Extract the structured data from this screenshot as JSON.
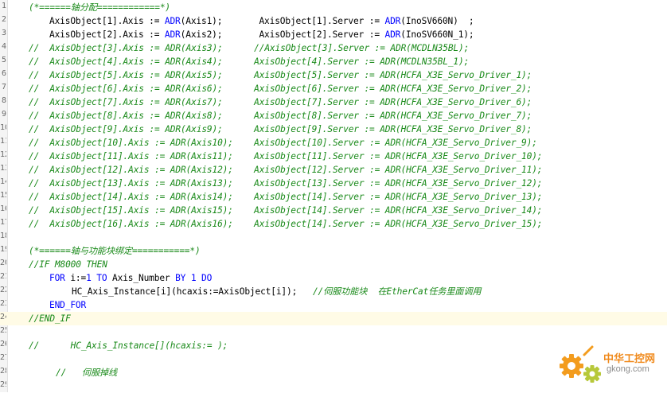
{
  "editor": {
    "lines": [
      {
        "num": "1",
        "segs": [
          {
            "t": "(*======轴分配============*)",
            "c": "cm"
          }
        ]
      },
      {
        "num": "2",
        "segs": [
          {
            "t": "AxisObject[1].Axis := ",
            "c": "txt"
          },
          {
            "t": "ADR",
            "c": "kw"
          },
          {
            "t": "(Axis1);       AxisObject[1].Server := ",
            "c": "txt"
          },
          {
            "t": "ADR",
            "c": "kw"
          },
          {
            "t": "(InoSV660N)  ;",
            "c": "txt"
          }
        ]
      },
      {
        "num": "3",
        "segs": [
          {
            "t": "AxisObject[2].Axis := ",
            "c": "txt"
          },
          {
            "t": "ADR",
            "c": "kw"
          },
          {
            "t": "(Axis2);       AxisObject[2].Server := ",
            "c": "txt"
          },
          {
            "t": "ADR",
            "c": "kw"
          },
          {
            "t": "(InoSV660N_1);",
            "c": "txt"
          }
        ]
      },
      {
        "num": "4",
        "segs": [
          {
            "t": "//  AxisObject[3].Axis := ADR(Axis3);      //AxisObject[3].Server := ADR(MCDLN35BL);",
            "c": "cm"
          }
        ]
      },
      {
        "num": "5",
        "segs": [
          {
            "t": "//  AxisObject[4].Axis := ADR(Axis4);      AxisObject[4].Server := ADR(MCDLN35BL_1);",
            "c": "cm"
          }
        ]
      },
      {
        "num": "6",
        "segs": [
          {
            "t": "//  AxisObject[5].Axis := ADR(Axis5);      AxisObject[5].Server := ADR(HCFA_X3E_Servo_Driver_1);",
            "c": "cm"
          }
        ]
      },
      {
        "num": "7",
        "segs": [
          {
            "t": "//  AxisObject[6].Axis := ADR(Axis6);      AxisObject[6].Server := ADR(HCFA_X3E_Servo_Driver_2);",
            "c": "cm"
          }
        ]
      },
      {
        "num": "8",
        "segs": [
          {
            "t": "//  AxisObject[7].Axis := ADR(Axis7);      AxisObject[7].Server := ADR(HCFA_X3E_Servo_Driver_6);",
            "c": "cm"
          }
        ]
      },
      {
        "num": "9",
        "segs": [
          {
            "t": "//  AxisObject[8].Axis := ADR(Axis8);      AxisObject[8].Server := ADR(HCFA_X3E_Servo_Driver_7);",
            "c": "cm"
          }
        ]
      },
      {
        "num": "10",
        "segs": [
          {
            "t": "//  AxisObject[9].Axis := ADR(Axis9);      AxisObject[9].Server := ADR(HCFA_X3E_Servo_Driver_8);",
            "c": "cm"
          }
        ]
      },
      {
        "num": "11",
        "segs": [
          {
            "t": "//  AxisObject[10].Axis := ADR(Axis10);    AxisObject[10].Server := ADR(HCFA_X3E_Servo_Driver_9);",
            "c": "cm"
          }
        ]
      },
      {
        "num": "12",
        "segs": [
          {
            "t": "//  AxisObject[11].Axis := ADR(Axis11);    AxisObject[11].Server := ADR(HCFA_X3E_Servo_Driver_10);",
            "c": "cm"
          }
        ]
      },
      {
        "num": "13",
        "segs": [
          {
            "t": "//  AxisObject[12].Axis := ADR(Axis12);    AxisObject[12].Server := ADR(HCFA_X3E_Servo_Driver_11);",
            "c": "cm"
          }
        ]
      },
      {
        "num": "14",
        "segs": [
          {
            "t": "//  AxisObject[13].Axis := ADR(Axis13);    AxisObject[13].Server := ADR(HCFA_X3E_Servo_Driver_12);",
            "c": "cm"
          }
        ]
      },
      {
        "num": "15",
        "segs": [
          {
            "t": "//  AxisObject[14].Axis := ADR(Axis14);    AxisObject[14].Server := ADR(HCFA_X3E_Servo_Driver_13);",
            "c": "cm"
          }
        ]
      },
      {
        "num": "16",
        "segs": [
          {
            "t": "//  AxisObject[15].Axis := ADR(Axis15);    AxisObject[14].Server := ADR(HCFA_X3E_Servo_Driver_14);",
            "c": "cm"
          }
        ]
      },
      {
        "num": "17",
        "segs": [
          {
            "t": "//  AxisObject[16].Axis := ADR(Axis16);    AxisObject[14].Server := ADR(HCFA_X3E_Servo_Driver_15);",
            "c": "cm"
          }
        ]
      },
      {
        "num": "18",
        "segs": []
      },
      {
        "num": "19",
        "segs": [
          {
            "t": "(*======轴与功能块绑定===========*)",
            "c": "cm"
          }
        ]
      },
      {
        "num": "20",
        "segs": [
          {
            "t": "//IF M8000 THEN",
            "c": "cm"
          }
        ]
      },
      {
        "num": "21",
        "segs": [
          {
            "t": "FOR",
            "c": "kw"
          },
          {
            "t": " i:=",
            "c": "txt"
          },
          {
            "t": "1",
            "c": "kw"
          },
          {
            "t": " ",
            "c": "txt"
          },
          {
            "t": "TO",
            "c": "kw"
          },
          {
            "t": " Axis_Number ",
            "c": "txt"
          },
          {
            "t": "BY",
            "c": "kw"
          },
          {
            "t": " ",
            "c": "txt"
          },
          {
            "t": "1",
            "c": "kw"
          },
          {
            "t": " ",
            "c": "txt"
          },
          {
            "t": "DO",
            "c": "kw"
          }
        ]
      },
      {
        "num": "22",
        "segs": [
          {
            "t": "HC_Axis_Instance[i](hcaxis:=AxisObject[i]);   ",
            "c": "txt"
          },
          {
            "t": "//伺服功能块  在EtherCat任务里面调用",
            "c": "cm"
          }
        ]
      },
      {
        "num": "23",
        "segs": [
          {
            "t": "END_FOR",
            "c": "kw"
          }
        ]
      },
      {
        "num": "24",
        "segs": [
          {
            "t": "//END_IF",
            "c": "cm"
          }
        ]
      },
      {
        "num": "25",
        "segs": []
      },
      {
        "num": "26",
        "segs": [
          {
            "t": "//      HC_Axis_Instance[](hcaxis:= );",
            "c": "cm"
          }
        ]
      },
      {
        "num": "27",
        "segs": []
      },
      {
        "num": "28",
        "segs": [
          {
            "t": "//   伺服掉线",
            "c": "cm"
          }
        ]
      },
      {
        "num": "29",
        "segs": []
      }
    ]
  },
  "watermark": {
    "title": "中华工控网",
    "domain": "gkong.com",
    "icon": "gear-icon",
    "gear_colors": [
      "#f39c1e",
      "#b7c83a"
    ]
  },
  "colors": {
    "keyword": "#0000ff",
    "comment": "#1a8a1a",
    "text": "#000000",
    "active_line": "#fffbe6"
  }
}
